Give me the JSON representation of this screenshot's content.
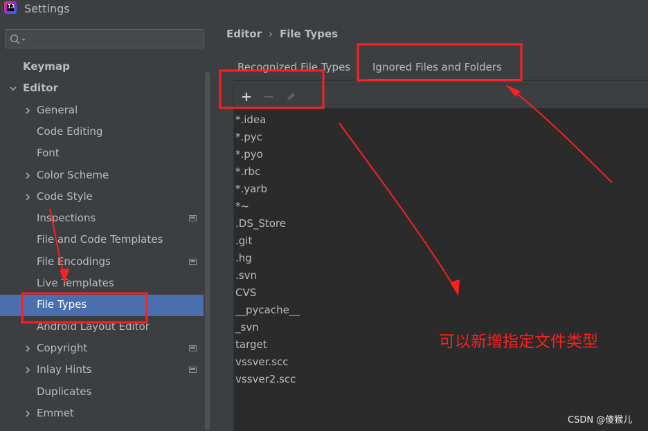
{
  "window": {
    "title": "Settings",
    "app_icon_text": "IJ"
  },
  "search": {
    "placeholder": "",
    "value": ""
  },
  "sidebar": {
    "items": [
      {
        "label": "Keymap",
        "indent": 0,
        "arrow": "none",
        "bold": true
      },
      {
        "label": "Editor",
        "indent": 0,
        "arrow": "expanded",
        "bold": true
      },
      {
        "label": "General",
        "indent": 1,
        "arrow": "collapsed"
      },
      {
        "label": "Code Editing",
        "indent": 1,
        "arrow": "none"
      },
      {
        "label": "Font",
        "indent": 1,
        "arrow": "none"
      },
      {
        "label": "Color Scheme",
        "indent": 1,
        "arrow": "collapsed"
      },
      {
        "label": "Code Style",
        "indent": 1,
        "arrow": "collapsed"
      },
      {
        "label": "Inspections",
        "indent": 1,
        "arrow": "none",
        "badge": true
      },
      {
        "label": "File and Code Templates",
        "indent": 1,
        "arrow": "none"
      },
      {
        "label": "File Encodings",
        "indent": 1,
        "arrow": "none",
        "badge": true
      },
      {
        "label": "Live Templates",
        "indent": 1,
        "arrow": "none"
      },
      {
        "label": "File Types",
        "indent": 1,
        "arrow": "none",
        "selected": true
      },
      {
        "label": "Android Layout Editor",
        "indent": 1,
        "arrow": "none"
      },
      {
        "label": "Copyright",
        "indent": 1,
        "arrow": "collapsed",
        "badge": true
      },
      {
        "label": "Inlay Hints",
        "indent": 1,
        "arrow": "collapsed",
        "badge": true
      },
      {
        "label": "Duplicates",
        "indent": 1,
        "arrow": "none"
      },
      {
        "label": "Emmet",
        "indent": 1,
        "arrow": "collapsed"
      }
    ]
  },
  "breadcrumb": {
    "parent": "Editor",
    "separator": "›",
    "current": "File Types"
  },
  "tabs": [
    {
      "label": "Recognized File Types",
      "active": false
    },
    {
      "label": "Ignored Files and Folders",
      "active": true
    }
  ],
  "toolbar": {
    "add_icon": "plus-icon",
    "remove_icon": "minus-icon",
    "edit_icon": "pencil-icon"
  },
  "ignored_files": [
    "*.idea",
    "*.pyc",
    "*.pyo",
    "*.rbc",
    "*.yarb",
    "*~",
    ".DS_Store",
    ".git",
    ".hg",
    ".svn",
    "CVS",
    "__pycache__",
    "_svn",
    "target",
    "vssver.scc",
    "vssver2.scc"
  ],
  "annotation": {
    "text": "可以新增指定文件类型",
    "color": "#ff1f1f"
  },
  "watermark": {
    "text": "CSDN @傻猴儿"
  },
  "colors": {
    "background": "#3c3f41",
    "list_background": "#2b2b2b",
    "selection": "#4b6eaf",
    "text": "#bbbbbb",
    "annotation_red": "#ff1f1f",
    "tab_underline": "#4a88c7"
  }
}
